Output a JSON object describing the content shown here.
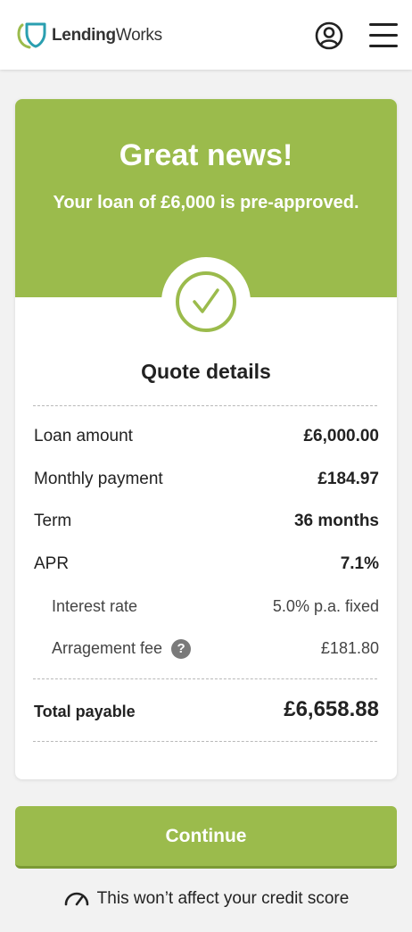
{
  "header": {
    "logo_text_bold": "Lending",
    "logo_text_regular": "Works",
    "account_icon": "user-circle-icon",
    "menu_icon": "hamburger-menu-icon"
  },
  "banner": {
    "title": "Great news!",
    "subtitle": "Your loan of £6,000 is pre-approved.",
    "icon": "checkmark-circle-icon"
  },
  "quote": {
    "title": "Quote details",
    "rows": [
      {
        "label": "Loan amount",
        "value": "£6,000.00"
      },
      {
        "label": "Monthly payment",
        "value": "£184.97"
      },
      {
        "label": "Term",
        "value": "36 months"
      },
      {
        "label": "APR",
        "value": "7.1%"
      }
    ],
    "sub_rows": [
      {
        "label": "Interest rate",
        "value": "5.0% p.a. fixed"
      },
      {
        "label": "Arragement fee",
        "value": "£181.80",
        "help_icon": "?"
      }
    ],
    "total": {
      "label": "Total payable",
      "value": "£6,658.88"
    }
  },
  "continue_label": "Continue",
  "credit_note": "This won’t affect your credit score",
  "colors": {
    "brand_green": "#9bbb4c",
    "button_border": "#7b9a34",
    "logo_teal": "#2a9fb0",
    "logo_green": "#9bbb4c"
  }
}
